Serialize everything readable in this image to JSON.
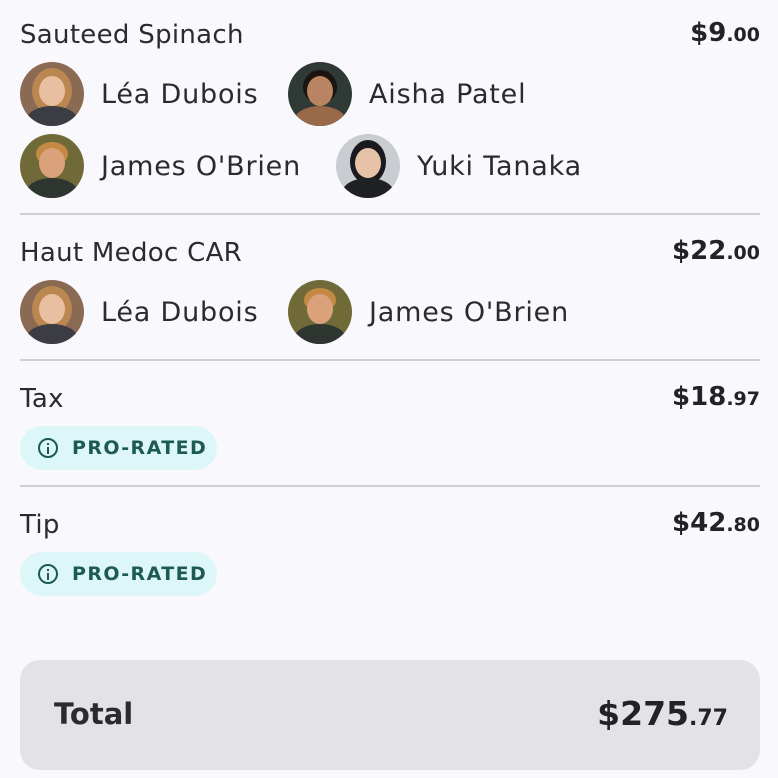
{
  "items": [
    {
      "name": "Sauteed Spinach",
      "price_dollars": "$9",
      "price_cents": ".00",
      "people": [
        "Léa Dubois",
        "Aisha Patel",
        "James O'Brien",
        "Yuki Tanaka"
      ]
    },
    {
      "name": "Haut Medoc CAR",
      "price_dollars": "$22",
      "price_cents": ".00",
      "people": [
        "Léa Dubois",
        "James O'Brien"
      ]
    }
  ],
  "tax": {
    "label": "Tax",
    "price_dollars": "$18",
    "price_cents": ".97",
    "badge": "PRO-RATED"
  },
  "tip": {
    "label": "Tip",
    "price_dollars": "$42",
    "price_cents": ".80",
    "badge": "PRO-RATED"
  },
  "total": {
    "label": "Total",
    "amount_dollars": "$275",
    "amount_cents": ".77"
  },
  "colors": {
    "badge_bg": "#ddf6f7",
    "badge_text": "#1d5b52",
    "total_card_bg": "#e2e2e7",
    "divider": "#cfcfd4"
  }
}
